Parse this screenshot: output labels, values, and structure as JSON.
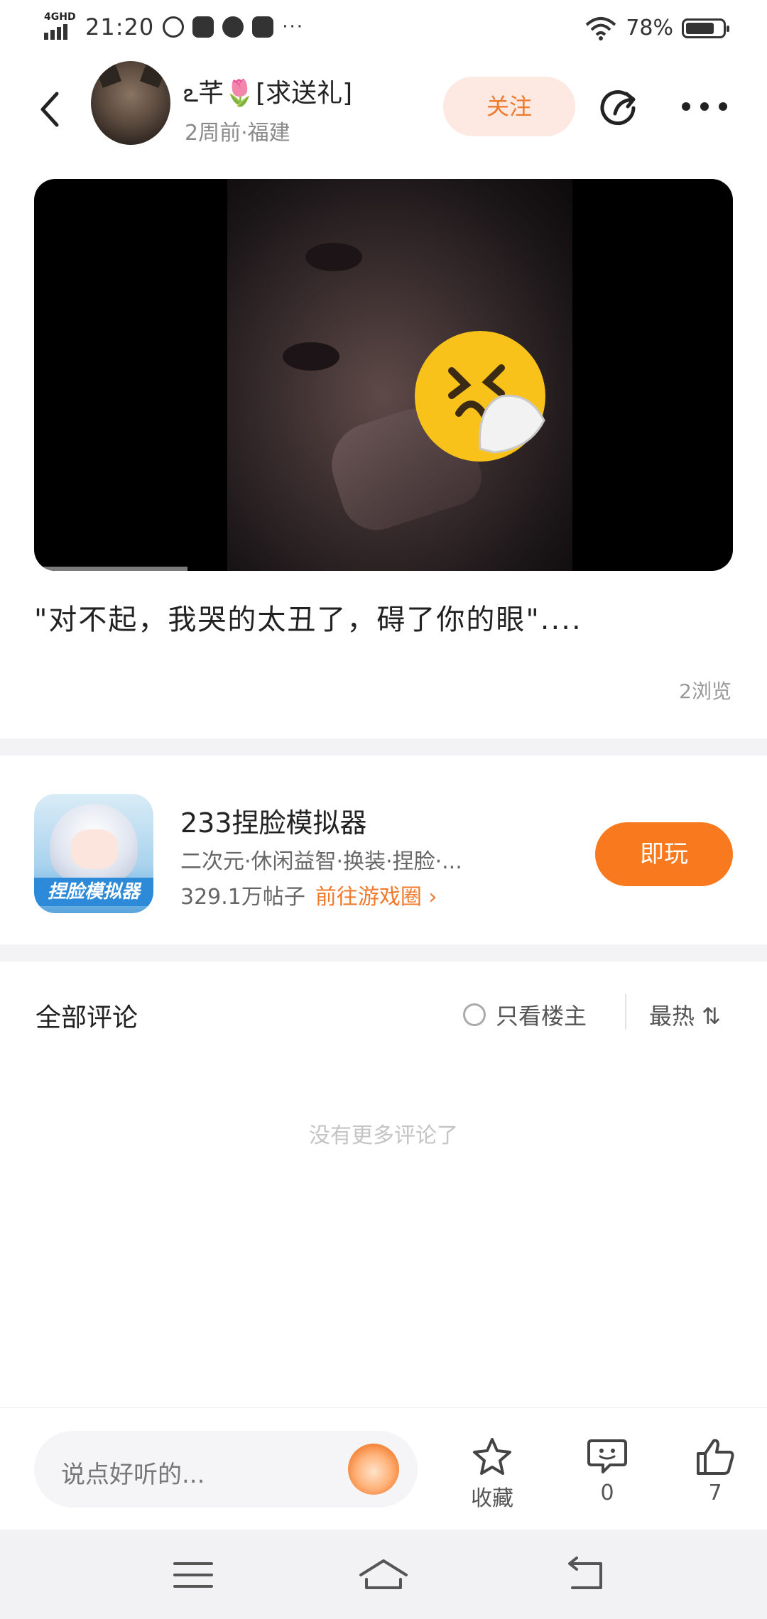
{
  "status_bar": {
    "network": "4GHD",
    "time": "21:20",
    "extra": "···",
    "battery_pct": "78%",
    "battery_level": 0.78
  },
  "header": {
    "user_name": "ఽ芊🌷[求送礼]",
    "meta": "2周前·福建",
    "follow_label": "关注"
  },
  "post": {
    "caption": "\"对不起，我哭的太丑了，碍了你的眼\"....",
    "views": "2浏览",
    "video_progress": 0.22
  },
  "game": {
    "icon_text": "捏脸模拟器",
    "title": "233捏脸模拟器",
    "tags": "二次元·休闲益智·换装·捏脸·...",
    "posts": "329.1万帖子",
    "link": "前往游戏圈 ›",
    "play_label": "即玩"
  },
  "comments": {
    "title": "全部评论",
    "only_host": "只看楼主",
    "sort": "最热 ⇅",
    "empty": "没有更多评论了"
  },
  "action_bar": {
    "input_placeholder": "说点好听的...",
    "favorite_label": "收藏",
    "comment_count": "0",
    "like_count": "7"
  }
}
